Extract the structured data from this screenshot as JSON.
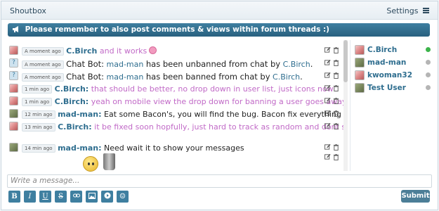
{
  "header": {
    "title": "Shoutbox",
    "settings_label": "Settings"
  },
  "notice": "Please remember to also post comments & views within forum threads :)",
  "messages": [
    {
      "avatar": "cbirch",
      "time": "A moment ago",
      "user": "C.Birch",
      "text": "and it works",
      "style": "pink",
      "emoji": "tongue-emoji"
    },
    {
      "avatar": "bot",
      "time": "A moment ago",
      "user": "Chat Bot:",
      "target": "mad-man",
      "mid": "has been unbanned from chat by",
      "by": "C.Birch",
      "end": ".",
      "style": "bot"
    },
    {
      "avatar": "bot",
      "time": "A moment ago",
      "user": "Chat Bot:",
      "target": "mad-man",
      "mid": "has been banned from chat by",
      "by": "C.Birch",
      "end": ".",
      "style": "bot"
    },
    {
      "avatar": "cbirch",
      "time": "1 min ago",
      "user": "C.Birch:",
      "text": "that should be better, no drop down in user list, just icons now",
      "style": "pink"
    },
    {
      "avatar": "cbirch",
      "time": "1 min ago",
      "user": "C.Birch:",
      "text": "yeah on mobile view the drop down for banning a user goes away",
      "style": "pink"
    },
    {
      "avatar": "madman",
      "time": "12 min ago",
      "user": "mad-man:",
      "text": "Eat some Bacon's, you will find the bug. Bacon fix everything",
      "style": "plain"
    },
    {
      "avatar": "cbirch",
      "time": "13 min ago",
      "user": "C.Birch:",
      "text": "it be fixed soon hopfully, just hard to track as random and dont show for everyone when happens",
      "style": "pink"
    },
    {
      "avatar": "madman",
      "time": "14 min ago",
      "user": "mad-man:",
      "text": "Need wait it to show your messages",
      "style": "plain"
    }
  ],
  "online_users": [
    {
      "name": "C.Birch",
      "avatar": "cbirch",
      "badge": "logout-icon",
      "status_color": "#3cb44b"
    },
    {
      "name": "mad-man",
      "avatar": "madman",
      "badge": "ban-user-icon",
      "status_color": "#b5b5b5"
    },
    {
      "name": "kwoman32",
      "avatar": "cbirch",
      "badge": "ban-user-icon",
      "status_color": "#b5b5b5"
    },
    {
      "name": "Test User",
      "avatar": "madman",
      "badge": "ban-user-icon",
      "status_color": "#b5b5b5"
    }
  ],
  "composer": {
    "placeholder": "Write a message..."
  },
  "format_buttons": [
    {
      "label": "B",
      "name": "bold-button"
    },
    {
      "label": "I",
      "name": "italic-button"
    },
    {
      "label": "U",
      "name": "underline-button"
    },
    {
      "label": "S",
      "name": "strikethrough-button"
    },
    {
      "label": "",
      "name": "link-button"
    },
    {
      "label": "",
      "name": "image-button"
    },
    {
      "label": "",
      "name": "video-button"
    },
    {
      "label": "☺",
      "name": "emoticon-button"
    }
  ],
  "submit_label": "Submit",
  "colors": {
    "accent": "#3f7fa0",
    "username": "#2f6e8f",
    "pink_text": "#c16ac7",
    "online": "#3cb44b",
    "offline": "#b5b5b5"
  }
}
